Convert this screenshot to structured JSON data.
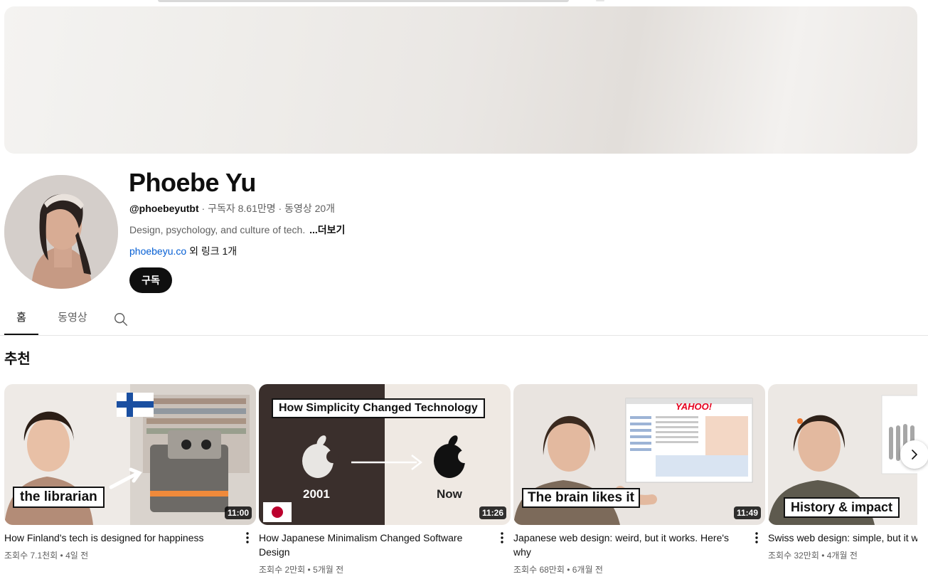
{
  "channel": {
    "name": "Phoebe Yu",
    "handle": "@phoebeyutbt",
    "stats": " · 구독자 8.61만명 · 동영상 20개",
    "description": "Design, psychology, and culture of tech.",
    "more_label": "...더보기",
    "link_url": "phoebeyu.co",
    "link_suffix": " 외 링크 1개",
    "subscribe_label": "구독"
  },
  "tabs": [
    {
      "label": "홈",
      "selected": true
    },
    {
      "label": "동영상",
      "selected": false
    }
  ],
  "section": {
    "title": "추천"
  },
  "videos": [
    {
      "title": "How Finland's tech is designed for happiness",
      "stats": "조회수 7.1천회 • 4일 전",
      "duration": "11:00",
      "thumb_text": "the librarian"
    },
    {
      "title": "How Japanese Minimalism Changed Software Design",
      "stats": "조회수 2만회 • 5개월 전",
      "duration": "11:26",
      "thumb_text": "How Simplicity Changed Technology",
      "thumb_year": "2001",
      "thumb_now": "Now"
    },
    {
      "title": "Japanese web design: weird, but it works. Here's why",
      "stats": "조회수 68만회 • 6개월 전",
      "duration": "11:49",
      "thumb_text": "The brain likes it",
      "thumb_logo": "YAHOO!"
    },
    {
      "title": "Swiss web design: simple, but it w",
      "stats": "조회수 32만회 • 4개월 전",
      "duration": "",
      "thumb_text": "History & impact"
    }
  ],
  "colors": {
    "text_primary": "#0f0f0f",
    "text_secondary": "#606060",
    "link": "#065fd4",
    "subscribe_bg": "#0f0f0f"
  },
  "icons": [
    "search-icon",
    "more-vert-icon",
    "chevron-right-icon"
  ]
}
